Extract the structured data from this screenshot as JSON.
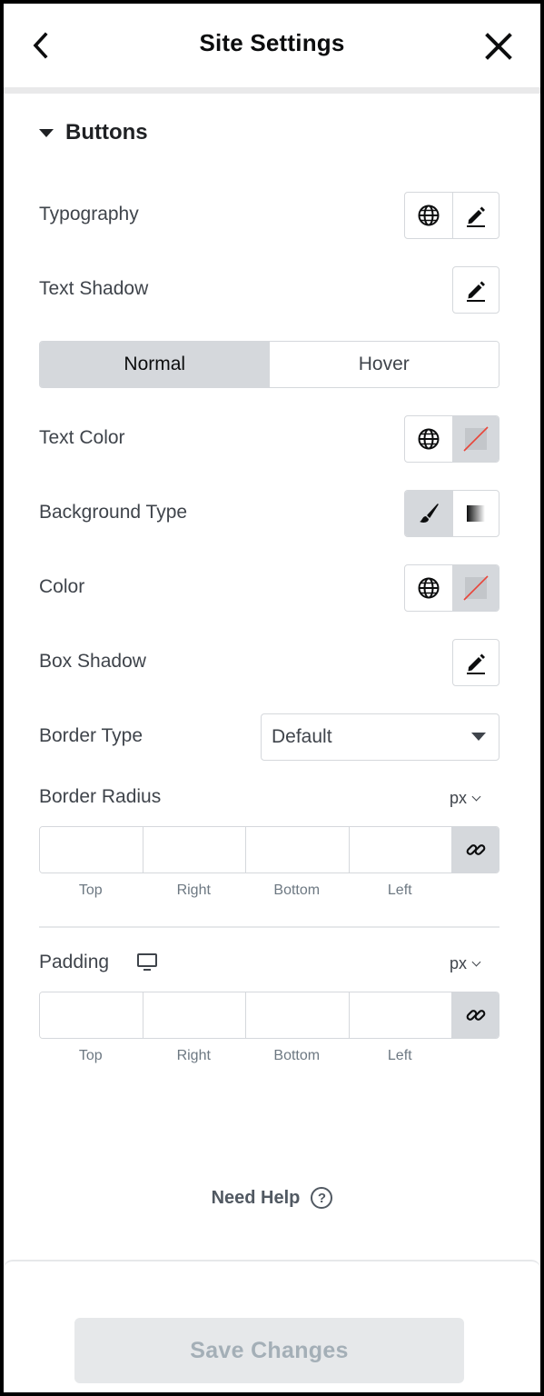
{
  "header": {
    "title": "Site Settings",
    "back_icon": "chevron-left-icon",
    "close_icon": "close-icon"
  },
  "section": {
    "title": "Buttons"
  },
  "rows": {
    "typography": "Typography",
    "text_shadow": "Text Shadow",
    "text_color": "Text Color",
    "background_type": "Background Type",
    "color": "Color",
    "box_shadow": "Box Shadow",
    "border_type": "Border Type",
    "border_radius": "Border Radius",
    "padding": "Padding"
  },
  "state_toggle": {
    "normal": "Normal",
    "hover": "Hover",
    "selected": "Normal"
  },
  "border_type_select": {
    "value": "Default"
  },
  "units": {
    "border_radius": "px",
    "padding": "px"
  },
  "dimension_labels": {
    "top": "Top",
    "right": "Right",
    "bottom": "Bottom",
    "left": "Left"
  },
  "help": {
    "label": "Need Help",
    "icon": "question-icon"
  },
  "footer": {
    "save_label": "Save Changes"
  },
  "colors": {
    "accent_grey": "#d5d8dc",
    "none_slash": "#e9453a"
  }
}
